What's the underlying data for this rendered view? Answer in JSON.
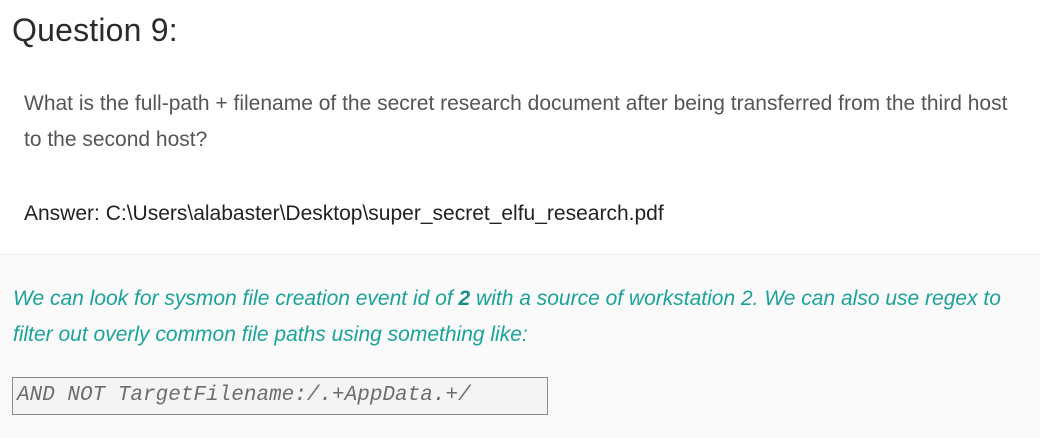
{
  "heading": "Question 9:",
  "question": "What is the full-path + filename of the secret research document after being transferred from the third host to the second host?",
  "answer": {
    "label": "Answer: ",
    "value": "C:\\Users\\alabaster\\Desktop\\super_secret_elfu_research.pdf"
  },
  "note": {
    "part1": "We can look for sysmon file creation event id of ",
    "event_id": "2",
    "part2": " with a source of workstation 2. We can also use regex to filter out overly common file paths using something like:"
  },
  "code": "AND NOT TargetFilename:/.+AppData.+/",
  "colors": {
    "note_text": "#1aa39a",
    "panel_bg": "#fafafa"
  }
}
